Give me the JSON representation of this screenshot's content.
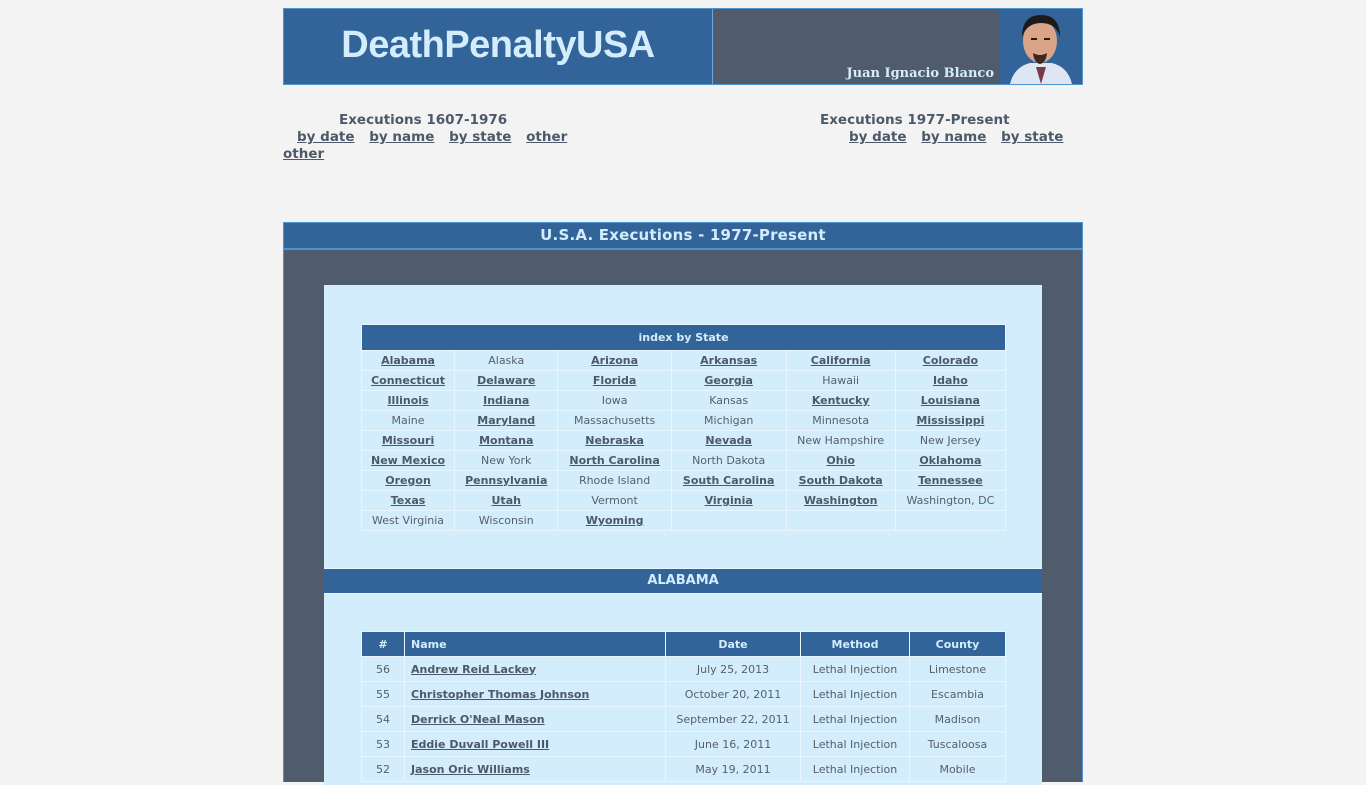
{
  "header": {
    "site_title": "DeathPenaltyUSA",
    "author": "Juan Ignacio Blanco",
    "portrait_icon": "author-portrait"
  },
  "nav": {
    "left": {
      "heading": "Executions 1607-1976",
      "links": [
        "by date",
        "by name",
        "by state",
        "other",
        "other"
      ]
    },
    "right": {
      "heading": "Executions 1977-Present",
      "links": [
        "by date",
        "by name",
        "by state"
      ]
    }
  },
  "panel": {
    "title": "U.S.A. Executions  -  1977-Present"
  },
  "state_index": {
    "heading": "index by State",
    "rows": [
      [
        {
          "name": "Alabama",
          "link": true
        },
        {
          "name": "Alaska",
          "link": false
        },
        {
          "name": "Arizona",
          "link": true
        },
        {
          "name": "Arkansas",
          "link": true
        },
        {
          "name": "California",
          "link": true
        },
        {
          "name": "Colorado",
          "link": true
        }
      ],
      [
        {
          "name": "Connecticut",
          "link": true
        },
        {
          "name": "Delaware",
          "link": true
        },
        {
          "name": "Florida",
          "link": true
        },
        {
          "name": "Georgia",
          "link": true
        },
        {
          "name": "Hawaii",
          "link": false
        },
        {
          "name": "Idaho",
          "link": true
        }
      ],
      [
        {
          "name": "Illinois",
          "link": true
        },
        {
          "name": "Indiana",
          "link": true
        },
        {
          "name": "Iowa",
          "link": false
        },
        {
          "name": "Kansas",
          "link": false
        },
        {
          "name": "Kentucky",
          "link": true
        },
        {
          "name": "Louisiana",
          "link": true
        }
      ],
      [
        {
          "name": "Maine",
          "link": false
        },
        {
          "name": "Maryland",
          "link": true
        },
        {
          "name": "Massachusetts",
          "link": false
        },
        {
          "name": "Michigan",
          "link": false
        },
        {
          "name": "Minnesota",
          "link": false
        },
        {
          "name": "Mississippi",
          "link": true
        }
      ],
      [
        {
          "name": "Missouri",
          "link": true
        },
        {
          "name": "Montana",
          "link": true
        },
        {
          "name": "Nebraska",
          "link": true
        },
        {
          "name": "Nevada",
          "link": true
        },
        {
          "name": "New Hampshire",
          "link": false
        },
        {
          "name": "New Jersey",
          "link": false
        }
      ],
      [
        {
          "name": "New Mexico",
          "link": true
        },
        {
          "name": "New York",
          "link": false
        },
        {
          "name": "North Carolina",
          "link": true
        },
        {
          "name": "North Dakota",
          "link": false
        },
        {
          "name": "Ohio",
          "link": true
        },
        {
          "name": "Oklahoma",
          "link": true
        }
      ],
      [
        {
          "name": "Oregon",
          "link": true
        },
        {
          "name": "Pennsylvania",
          "link": true
        },
        {
          "name": "Rhode Island",
          "link": false
        },
        {
          "name": "South Carolina",
          "link": true
        },
        {
          "name": "South Dakota",
          "link": true
        },
        {
          "name": "Tennessee",
          "link": true
        }
      ],
      [
        {
          "name": "Texas",
          "link": true
        },
        {
          "name": "Utah",
          "link": true
        },
        {
          "name": "Vermont",
          "link": false
        },
        {
          "name": "Virginia",
          "link": true
        },
        {
          "name": "Washington",
          "link": true
        },
        {
          "name": "Washington, DC",
          "link": false
        }
      ],
      [
        {
          "name": "West Virginia",
          "link": false
        },
        {
          "name": "Wisconsin",
          "link": false
        },
        {
          "name": "Wyoming",
          "link": true
        },
        {
          "name": "",
          "link": false
        },
        {
          "name": "",
          "link": false
        },
        {
          "name": "",
          "link": false
        }
      ]
    ]
  },
  "section": {
    "title": "ALABAMA"
  },
  "executions": {
    "columns": [
      "#",
      "Name",
      "Date",
      "Method",
      "County"
    ],
    "rows": [
      {
        "num": "56",
        "name": "Andrew Reid Lackey",
        "date": "July 25, 2013",
        "method": "Lethal Injection",
        "county": "Limestone"
      },
      {
        "num": "55",
        "name": "Christopher Thomas Johnson",
        "date": "October 20, 2011",
        "method": "Lethal Injection",
        "county": "Escambia"
      },
      {
        "num": "54",
        "name": "Derrick O'Neal Mason",
        "date": "September 22, 2011",
        "method": "Lethal Injection",
        "county": "Madison"
      },
      {
        "num": "53",
        "name": "Eddie Duvall Powell III",
        "date": "June 16, 2011",
        "method": "Lethal Injection",
        "county": "Tuscaloosa"
      },
      {
        "num": "52",
        "name": "Jason Oric Williams",
        "date": "May 19, 2011",
        "method": "Lethal Injection",
        "county": "Mobile"
      }
    ]
  }
}
